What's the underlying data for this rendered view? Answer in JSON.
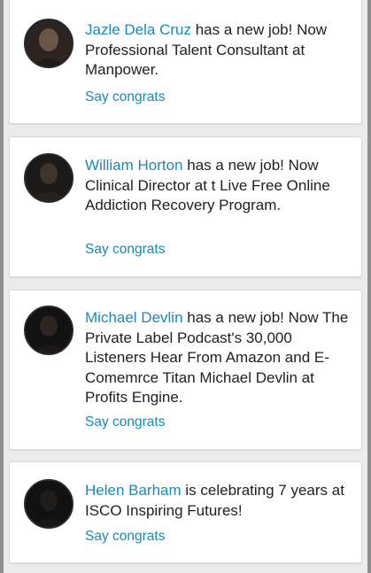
{
  "notifications": [
    {
      "name": "Jazle Dela Cruz",
      "message": " has a new job! Now Professional Talent Consultant at Manpower.",
      "action": "Say congrats"
    },
    {
      "name": "William Horton",
      "message": " has a new job! Now Clinical Director at t Live Free Online Addiction Recovery Program.",
      "action": "Say congrats"
    },
    {
      "name": "Michael Devlin",
      "message": " has a new job! Now The Private Label Podcast's 30,000 Listeners Hear From Amazon and E-Comemrce Titan Michael Devlin at Profits Engine.",
      "action": "Say congrats"
    },
    {
      "name": "Helen Barham",
      "message": " is celebrating 7 years at ISCO Inspiring Futures!",
      "action": "Say congrats"
    }
  ],
  "colors": {
    "link": "#1a8ab6",
    "text": "#1f1f1f",
    "card_background": "#ffffff",
    "panel_background": "#ebebeb",
    "frame": "#8e8e8e"
  },
  "icons": {
    "avatar": "profile-photo"
  }
}
